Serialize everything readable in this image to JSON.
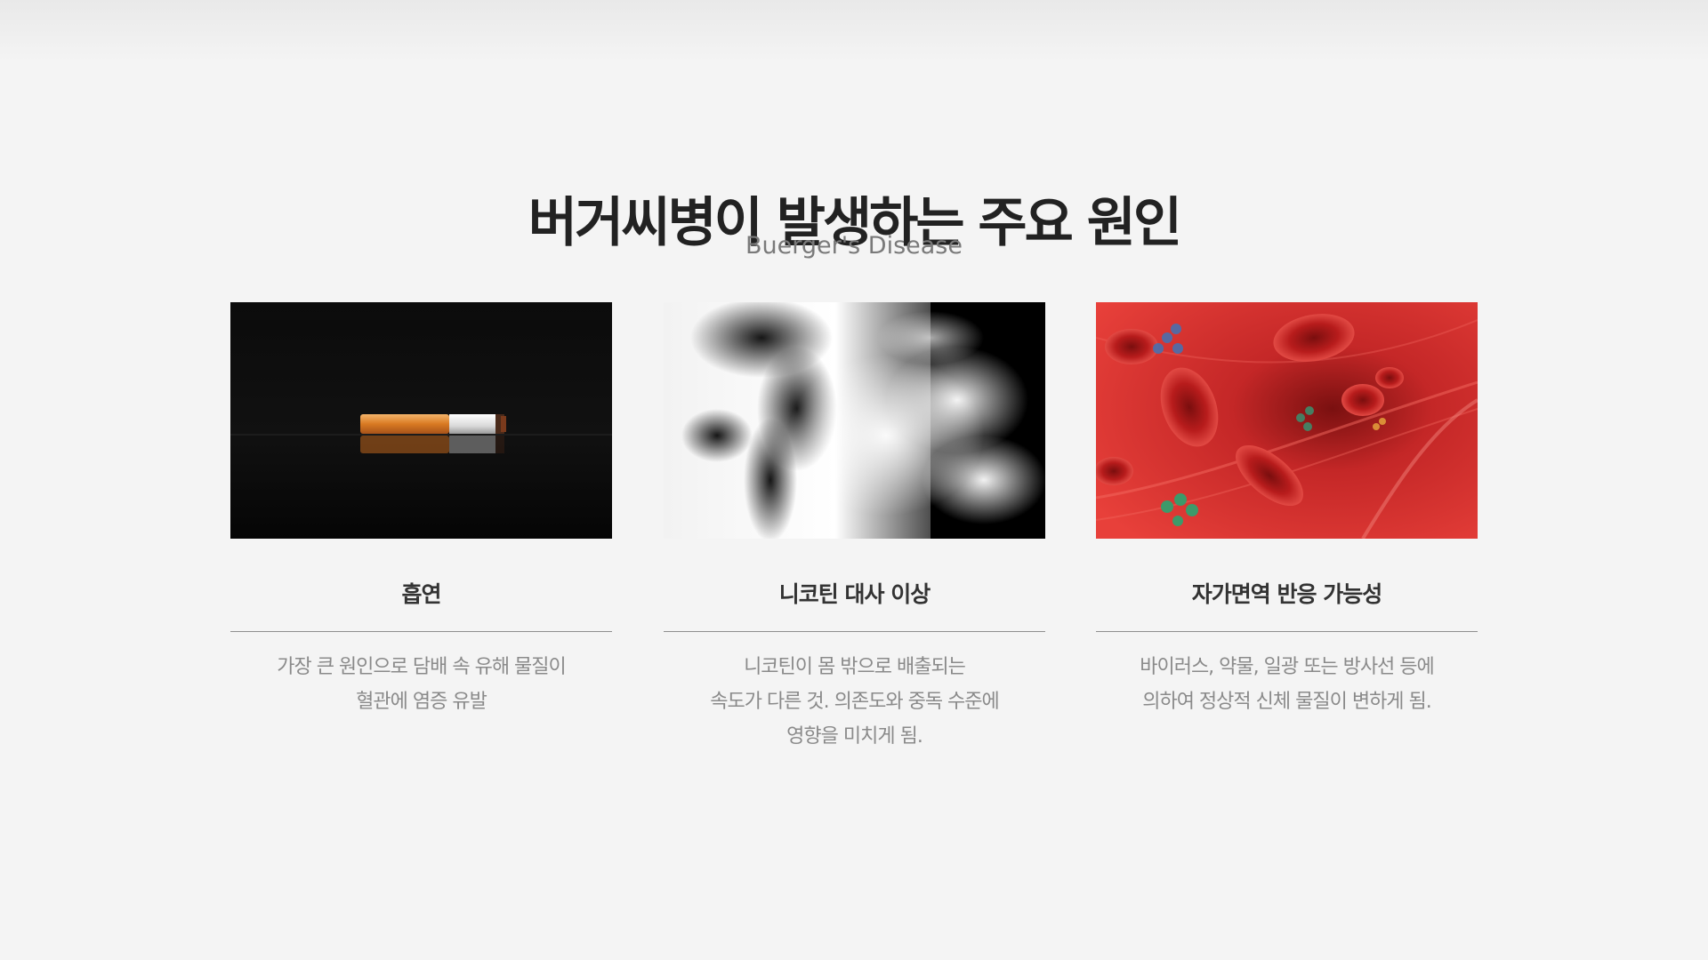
{
  "section": {
    "title": "버거씨병이 발생하는 주요 원인",
    "subtitle": "Buerger's Disease"
  },
  "cards": [
    {
      "image_icon": "cigarette-image",
      "title": "흡연",
      "lines": [
        "가장 큰 원인으로 담배 속 유해 물질이",
        "혈관에 염증 유발"
      ]
    },
    {
      "image_icon": "smoke-image",
      "title": "니코틴 대사 이상",
      "lines": [
        "니코틴이 몸 밖으로 배출되는",
        "속도가 다른 것. 의존도와 중독 수준에",
        "영향을 미치게 됨."
      ]
    },
    {
      "image_icon": "blood-vessel-image",
      "title": "자가면역 반응 가능성",
      "lines": [
        "바이러스, 약물, 일광 또는 방사선 등에",
        "의하여 정상적 신체 물질이 변하게 됨."
      ]
    }
  ],
  "colors": {
    "background": "#f4f4f4",
    "title": "#222222",
    "subtitle": "#7a7a7a",
    "body_text": "#8a8a8a",
    "divider": "#8f8f8f",
    "vessel_red": "#d62f2f"
  }
}
